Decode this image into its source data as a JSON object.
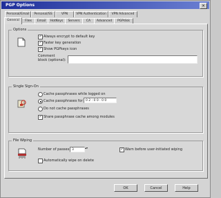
{
  "window": {
    "title": "PGP Options",
    "close_glyph": "×"
  },
  "tabs_row1": [
    "Personal/Email",
    "Personal/SS",
    "VPN",
    "VPN Authentication",
    "VPN Advanced"
  ],
  "tabs_row2": [
    "General",
    "Files",
    "Email",
    "HotKeys",
    "Servers",
    "CA",
    "Advanced",
    "PGPdisk"
  ],
  "active_tab": "General",
  "options": {
    "label": "Options",
    "always_encrypt": {
      "label": "Always encrypt to default key",
      "checked": true
    },
    "faster_keygen": {
      "label": "Faster key generation",
      "checked": true
    },
    "show_pgpkeys": {
      "label": "Show PGPkeys icon",
      "checked": true
    },
    "comment_label_1": "Comment",
    "comment_label_2": "block (optional):",
    "comment_value": ""
  },
  "single_signon": {
    "label": "Single Sign-On",
    "cache_logged_on": "Cache passphrases while logged on",
    "cache_for": "Cache passphrases for",
    "cache_duration": "0 2 : 0 0 : 0 0",
    "no_cache": "Do not cache passphrases",
    "share_cache": {
      "label": "Share passphrase cache among modules",
      "checked": true
    },
    "selected_mode": "cache_for"
  },
  "file_wiping": {
    "label": "File Wiping",
    "passes_label_1": "Number of passes:",
    "passes_value": "3",
    "warn_before_wipe": {
      "label": "Warn before user-initiated wiping",
      "checked": true
    },
    "auto_wipe": {
      "label": "Automatically wipe on delete",
      "checked": false
    }
  },
  "buttons": {
    "ok": "OK",
    "cancel": "Cancel",
    "help": "Help"
  }
}
